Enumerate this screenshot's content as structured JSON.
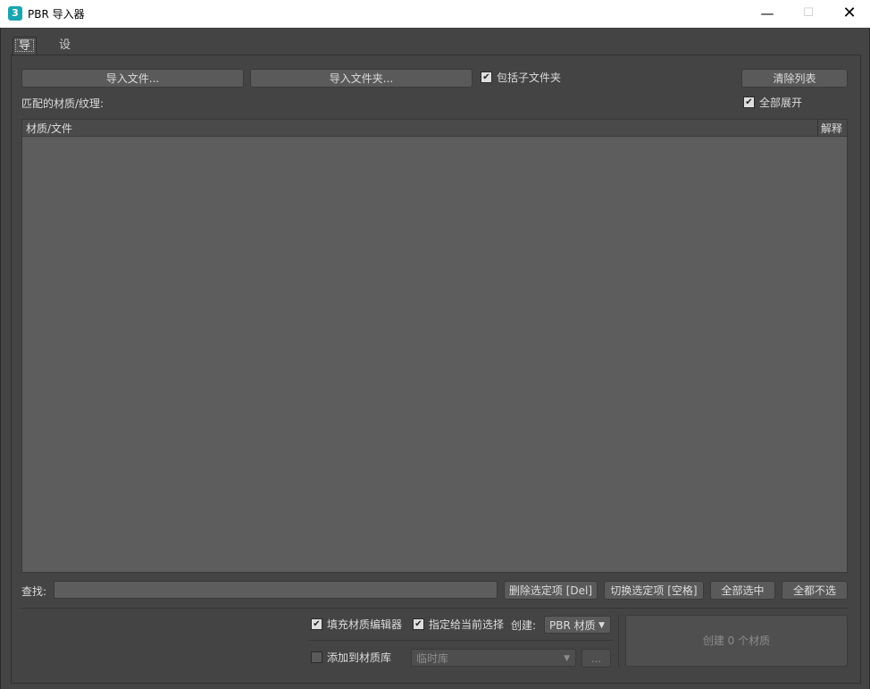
{
  "window": {
    "icon_glyph": "3",
    "title": "PBR 导入器",
    "minimize_glyph": "—",
    "maximize_glyph": "☐",
    "close_glyph": "✕"
  },
  "tabs": [
    {
      "label": "导入",
      "active": true
    },
    {
      "label": "设置",
      "active": false
    }
  ],
  "toolbar": {
    "import_files": "导入文件...",
    "import_folder": "导入文件夹...",
    "include_subfolders": "包括子文件夹",
    "include_subfolders_checked": true,
    "clear_list": "清除列表"
  },
  "list": {
    "label": "匹配的材质/纹理:",
    "expand_all": "全部展开",
    "expand_all_checked": true,
    "columns": [
      "材质/文件",
      "解释"
    ],
    "rows": []
  },
  "search": {
    "label": "查找:",
    "value": "",
    "remove_selected": "删除选定项 [Del]",
    "toggle_selected": "切换选定项 [空格]",
    "select_all": "全部选中",
    "select_none": "全都不选"
  },
  "options": {
    "fill_material_editor": "填充材质编辑器",
    "fill_material_editor_checked": true,
    "assign_to_selection": "指定给当前选择",
    "assign_to_selection_checked": true,
    "create_label": "创建:",
    "create_type": "PBR 材质",
    "add_to_library": "添加到材质库",
    "add_to_library_checked": false,
    "library_value": "临时库",
    "browse": "...",
    "create_button": "创建 0 个材质"
  },
  "glyphs": {
    "check": "✔",
    "dropdown": "▼"
  }
}
